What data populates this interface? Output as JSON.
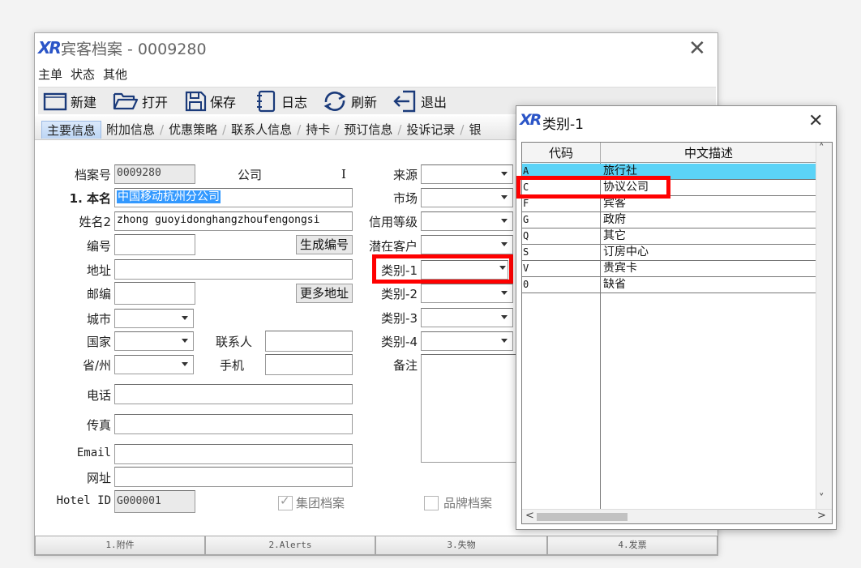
{
  "window": {
    "logo": "XR",
    "title": "宾客档案 - 0009280",
    "close": "✕"
  },
  "menu": [
    "主单",
    "状态",
    "其他"
  ],
  "toolbar": {
    "new": "新建",
    "open": "打开",
    "save": "保存",
    "log": "日志",
    "refresh": "刷新",
    "exit": "退出"
  },
  "tabs": [
    "主要信息",
    "附加信息",
    "优惠策略",
    "联系人信息",
    "持卡",
    "预订信息",
    "投诉记录",
    "银"
  ],
  "form": {
    "archive_no_label": "档案号",
    "archive_no": "0009280",
    "company_label": "公司",
    "company_flag": "I",
    "name_label": "1. 本名",
    "name": "中国移动杭州分公司",
    "name2_label": "姓名2",
    "name2": "zhong guoyidonghangzhoufengongsi",
    "code_label": "编号",
    "code": "",
    "gen_code_button": "生成编号",
    "address_label": "地址",
    "address": "",
    "zip_label": "邮编",
    "zip": "",
    "more_address_button": "更多地址",
    "city_label": "城市",
    "country_label": "国家",
    "contact_label": "联系人",
    "province_label": "省/州",
    "mobile_label": "手机",
    "phone_label": "电话",
    "fax_label": "传真",
    "email_label": "Email",
    "website_label": "网址",
    "hotel_id_label": "Hotel ID",
    "hotel_id": "G000001",
    "group_archive": "集团档案",
    "brand_archive": "品牌档案",
    "source_label": "来源",
    "market_label": "市场",
    "credit_label": "信用等级",
    "potential_label": "潜在客户",
    "category1_label": "类别-1",
    "category2_label": "类别-2",
    "category3_label": "类别-3",
    "category4_label": "类别-4",
    "remark_label": "备注"
  },
  "footer": [
    "1.附件",
    "2.Alerts",
    "3.失物",
    "4.发票"
  ],
  "popup": {
    "logo": "XR",
    "title": "类别-1",
    "close": "✕",
    "col_code": "代码",
    "col_desc": "中文描述",
    "rows": [
      {
        "code": "A",
        "desc": "旅行社"
      },
      {
        "code": "C",
        "desc": "协议公司"
      },
      {
        "code": "F",
        "desc": "宾客"
      },
      {
        "code": "G",
        "desc": "政府"
      },
      {
        "code": "Q",
        "desc": "其它"
      },
      {
        "code": "S",
        "desc": "订房中心"
      },
      {
        "code": "V",
        "desc": "贵宾卡"
      },
      {
        "code": "0",
        "desc": "缺省"
      }
    ],
    "selected_row": 0,
    "scroll_up": "˄",
    "scroll_down": "˅",
    "scroll_left": "<",
    "scroll_right": ">"
  },
  "colors": {
    "selection": "#5bd3f7",
    "highlight_box": "#ff0000",
    "tab_active": "#c8dcf6"
  }
}
